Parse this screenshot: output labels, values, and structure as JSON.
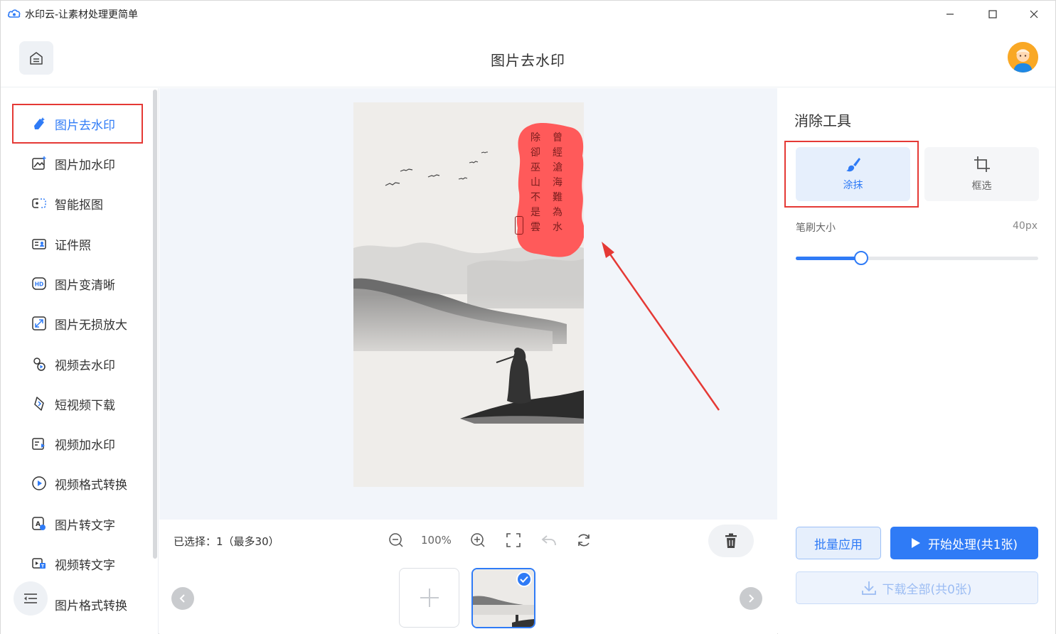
{
  "window": {
    "title": "水印云-让素材处理更简单"
  },
  "header": {
    "title": "图片去水印"
  },
  "sidebar": {
    "items": [
      {
        "label": "图片去水印",
        "icon": "eraser-icon",
        "active": true
      },
      {
        "label": "图片加水印",
        "icon": "image-add-icon",
        "active": false
      },
      {
        "label": "智能抠图",
        "icon": "cutout-icon",
        "active": false
      },
      {
        "label": "证件照",
        "icon": "id-photo-icon",
        "active": false
      },
      {
        "label": "图片变清晰",
        "icon": "hd-icon",
        "active": false
      },
      {
        "label": "图片无损放大",
        "icon": "enlarge-icon",
        "active": false
      },
      {
        "label": "视频去水印",
        "icon": "video-eraser-icon",
        "active": false
      },
      {
        "label": "短视频下载",
        "icon": "video-download-icon",
        "active": false
      },
      {
        "label": "视频加水印",
        "icon": "video-add-icon",
        "active": false
      },
      {
        "label": "视频格式转换",
        "icon": "video-convert-icon",
        "active": false
      },
      {
        "label": "图片转文字",
        "icon": "image-ocr-icon",
        "active": false
      },
      {
        "label": "视频转文字",
        "icon": "video-ocr-icon",
        "active": false
      },
      {
        "label": "图片格式转换",
        "icon": "image-convert-icon",
        "active": false
      }
    ]
  },
  "canvas": {
    "photo_text": {
      "col1": "曾經滄海難為水",
      "col2": "除卻巫山不是雲"
    }
  },
  "toolbar": {
    "selection_text": "已选择：1（最多30）",
    "zoom": "100%"
  },
  "panel": {
    "title": "消除工具",
    "tools": [
      {
        "label": "涂抹",
        "icon": "brush-icon",
        "active": true
      },
      {
        "label": "框选",
        "icon": "crop-icon",
        "active": false
      }
    ],
    "brush_size_label": "笔刷大小",
    "brush_size_value": "40px",
    "brush_size_fraction": 0.27,
    "batch_button": "批量应用",
    "start_button": "开始处理(共1张)",
    "download_button": "下载全部(共0张)"
  },
  "colors": {
    "accent": "#2f7bf6",
    "highlight": "#e53935",
    "brush_overlay": "#ff5a5a"
  }
}
